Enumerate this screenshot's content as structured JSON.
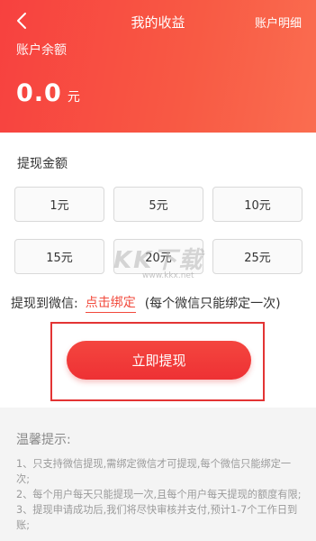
{
  "header": {
    "title": "我的收益",
    "detail_link": "账户明细",
    "balance_label": "账户余额",
    "balance_value": "0.0",
    "balance_unit": "元",
    "back_icon": "chevron-left-icon",
    "bg_color": "#f7413f"
  },
  "withdraw": {
    "section_label": "提现金额",
    "amounts": [
      "1元",
      "5元",
      "10元",
      "15元",
      "20元",
      "25元"
    ],
    "bind_label": "提现到微信:",
    "bind_link": "点击绑定",
    "bind_note": "(每个微信只能绑定一次)",
    "button_label": "立即提现",
    "accent_color": "#f24a3c"
  },
  "watermark": {
    "text": "KK下载",
    "sub": "www.kkx.net"
  },
  "tips": {
    "title": "温馨提示:",
    "items": [
      "1、只支持微信提现,需绑定微信才可提现,每个微信只能绑定一次;",
      "2、每个用户每天只能提现一次,且每个用户每天提现的额度有限;",
      "3、提现申请成功后,我们将尽快审核并支付,预计1-7个工作日到账;"
    ]
  }
}
